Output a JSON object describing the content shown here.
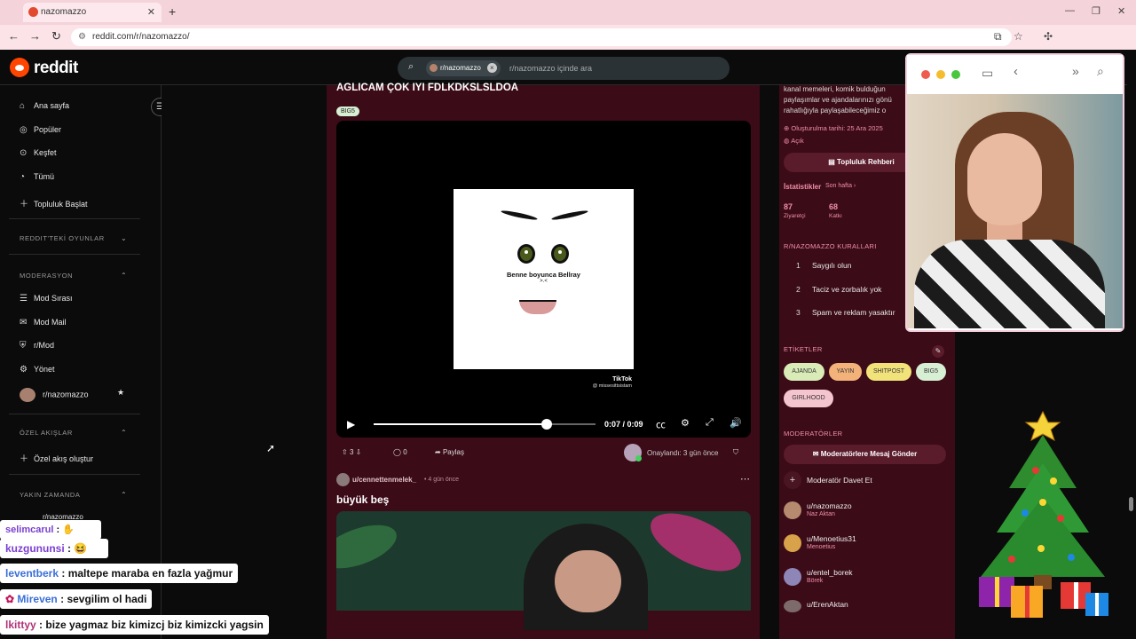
{
  "browser": {
    "tab_title": "nazomazzo",
    "url": "reddit.com/r/nazomazzo/"
  },
  "reddit": {
    "logo_text": "reddit",
    "search_chip": "r/nazomazzo",
    "search_placeholder": "r/nazomazzo içinde ara"
  },
  "sidebar": {
    "items": [
      {
        "label": "Ana sayfa",
        "icon": "home-icon"
      },
      {
        "label": "Popüler",
        "icon": "popular-icon"
      },
      {
        "label": "Keşfet",
        "icon": "explore-icon"
      },
      {
        "label": "Tümü",
        "icon": "all-icon"
      },
      {
        "label": "Topluluk Başlat",
        "icon": "plus-icon"
      }
    ],
    "section_games": "REDDIT'TEKİ OYUNLAR",
    "section_mod": "MODERASYON",
    "mod_items": [
      {
        "label": "Mod Sırası",
        "icon": "queue-icon"
      },
      {
        "label": "Mod Mail",
        "icon": "mail-icon"
      },
      {
        "label": "r/Mod",
        "icon": "mod-icon"
      },
      {
        "label": "Yönet",
        "icon": "manage-icon"
      },
      {
        "label": "r/nazomazzo",
        "icon": "avatar"
      }
    ],
    "section_feeds": "ÖZEL AKIŞLAR",
    "create_feed": "Özel akış oluştur",
    "section_recent": "YAKIN ZAMANDA",
    "recent_item": "r/nazomazzo"
  },
  "post1": {
    "title": "AGLICAM ÇOK IYI FDLKDKSLSLDOA",
    "flair": "BIG5",
    "video_caption": "Benne boyunca Bellray",
    "video_subcaption": ">.<",
    "tiktok_label": "TikTok",
    "tiktok_handle": "@ missesittsistam",
    "time": "0:07 / 0:09",
    "progress": 0.78,
    "upvotes": "3",
    "comments": "0",
    "share": "Paylaş",
    "approved": "Onaylandı: 3 gün önce"
  },
  "post2": {
    "user": "u/cennettenmelek_",
    "time": "• 4 gün önce",
    "title": "büyük beş"
  },
  "right": {
    "about_lines": [
      "kanal memeleri, komik bulduğun",
      "paylaşımlar ve ajandalarınızı gönü",
      "rahatlığıyla paylaşabileceğimiz o"
    ],
    "created": "Oluşturulma tarihi: 25 Ara 2025",
    "status": "Açık",
    "guide_button": "Topluluk Rehberi",
    "stats_label": "İstatistikler",
    "stats_period": "Son hafta",
    "visits_value": "87",
    "visits_label": "Ziyaretçi",
    "contrib_value": "68",
    "contrib_label": "Katkı",
    "rules_title": "R/NAZOMAZZO KURALLARI",
    "rules": [
      {
        "n": "1",
        "text": "Saygılı olun"
      },
      {
        "n": "2",
        "text": "Taciz ve zorbalık yok"
      },
      {
        "n": "3",
        "text": "Spam ve reklam yasaktır"
      }
    ],
    "tags_title": "ETİKETLER",
    "tags": [
      {
        "label": "AJANDA",
        "color": "#d9ecb8"
      },
      {
        "label": "YAYIN",
        "color": "#f3b27a"
      },
      {
        "label": "SHITPOST",
        "color": "#f2e27a"
      },
      {
        "label": "BIG5",
        "color": "#d7efd3"
      },
      {
        "label": "GIRLHOOD",
        "color": "#f5c5cf"
      }
    ],
    "mods_title": "MODERATÖRLER",
    "mod_mail_button": "Moderatörlere Mesaj Gönder",
    "invite_mod": "Moderatör Davet Et",
    "moderators": [
      {
        "user": "u/nazomazzo",
        "flair": "Naz Aktan"
      },
      {
        "user": "u/Menoetius31",
        "flair": "Menoetius"
      },
      {
        "user": "u/entel_borek",
        "flair": "Börek"
      },
      {
        "user": "u/ErenAktan",
        "flair": ""
      }
    ]
  },
  "chat": [
    {
      "name": "selimcarul",
      "msg": ":",
      "color": "#7b3fd1"
    },
    {
      "name": "kuzgununsi",
      "msg": ":",
      "color": "#7b3fd1"
    },
    {
      "name": "leventberk",
      "msg": ": maltepe maraba en fazla yağmur",
      "color": "#3a6fd8"
    },
    {
      "name": "Mireven",
      "msg": ": sevgilim ol hadi",
      "color": "#3a6fd8"
    },
    {
      "name": "lkittyy",
      "msg": ": bize yagmaz biz kimizcj biz kimizcki yagsin",
      "color": "#b0347a"
    }
  ],
  "colors": {
    "reddit_orange": "#ff4500",
    "feed_bg": "#3b0b17",
    "tab_bg": "#f4d3da"
  }
}
